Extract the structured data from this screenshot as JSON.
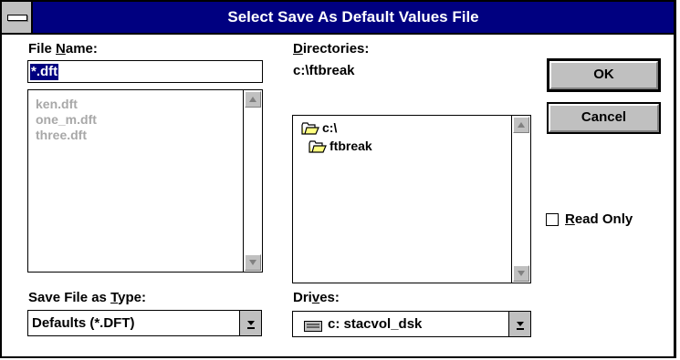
{
  "window": {
    "title": "Select Save As Default Values File"
  },
  "filename": {
    "label_pre": "File ",
    "label_accel": "N",
    "label_post": "ame:",
    "value": "*.dft",
    "files": [
      "ken.dft",
      "one_m.dft",
      "three.dft"
    ]
  },
  "directories": {
    "label_accel": "D",
    "label_post": "irectories:",
    "current_path": "c:\\ftbreak",
    "items": [
      {
        "name": "c:\\",
        "icon": "folder-open-icon"
      },
      {
        "name": "ftbreak",
        "icon": "folder-open-icon"
      }
    ]
  },
  "buttons": {
    "ok": "OK",
    "cancel": "Cancel"
  },
  "read_only": {
    "accel": "R",
    "label_post": "ead Only",
    "checked": false
  },
  "file_type": {
    "label_pre": "Save File as ",
    "label_accel": "T",
    "label_post": "ype:",
    "value": "Defaults (*.DFT)"
  },
  "drives": {
    "label_pre": "Dri",
    "label_accel": "v",
    "label_post": "es:",
    "value": "c: stacvol_dsk",
    "icon": "drive-icon"
  },
  "colors": {
    "titlebar": "#000080",
    "face": "#c0c0c0",
    "disabled_text": "#a8a8a8"
  }
}
